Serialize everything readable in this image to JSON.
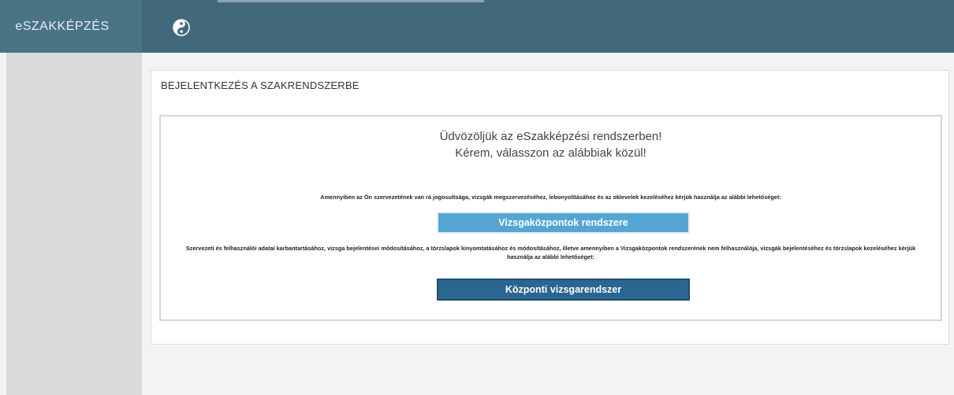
{
  "header": {
    "brand": "eSZAKKÉPZÉS",
    "toggle_icon": "yin-yang-icon",
    "bg_color": "#42697b"
  },
  "panel": {
    "title": "BEJELENTKEZÉS A SZAKRENDSZERBE",
    "welcome_line1": "Üdvözöljük az eSzakképzési rendszerben!",
    "welcome_line2": "Kérem, válasszon az alábbiak közül!",
    "desc1": "Amennyiben az Ön szervezetének van rá jogosultsága, vizsgák megszervezéséhez, lebonyolításához és az oklevelek kezeléséhez kérjük használja az alábbi lehetőséget:",
    "button1": "Vizsgaközpontok rendszere",
    "desc2": "Szervezeti és felhasználói adatai karbantartásához, vizsga bejelentései módosításához, a törzslapok kinyomtatásához és módosításához, illetve amennyiben a Vizsgaközpontok rendszerének nem felhasználója, vizsgák bejelentéséhez és törzslapok kezeléséhez kérjük használja az alábbi lehetőséget:",
    "button2": "Központi vizsgarendszer"
  },
  "colors": {
    "button1": "#55a5d4",
    "button2": "#2a6690"
  }
}
